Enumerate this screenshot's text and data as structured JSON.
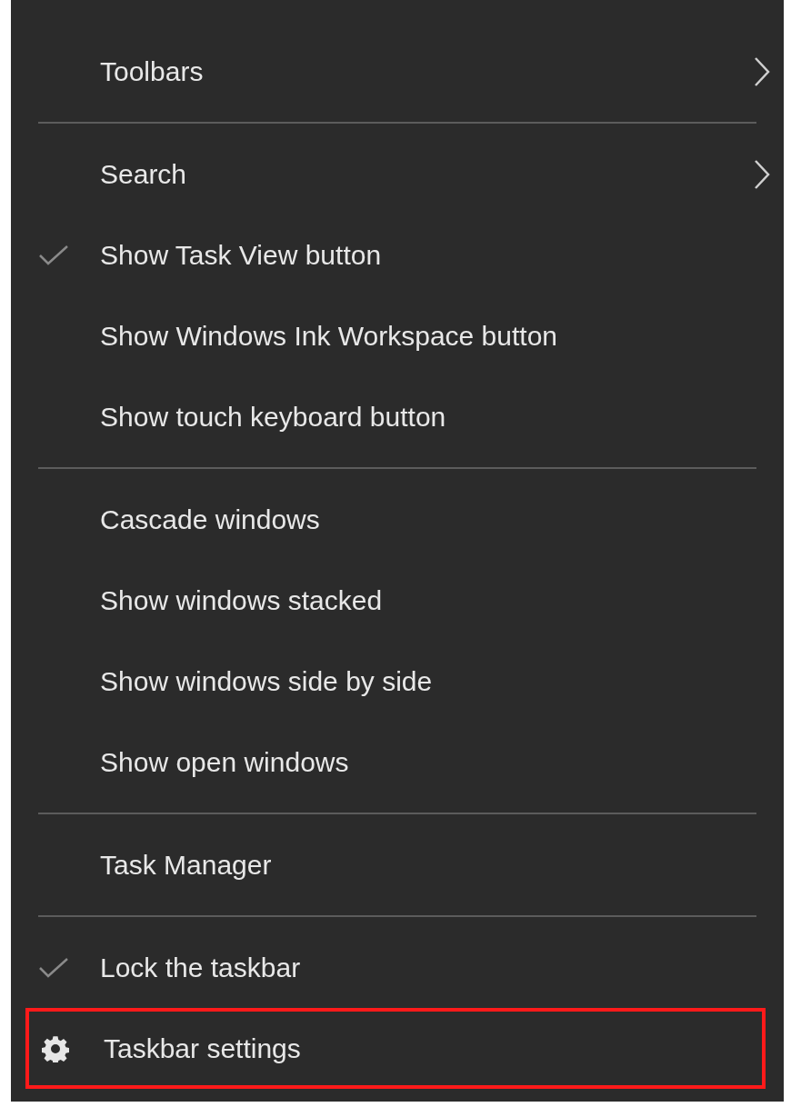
{
  "menu": {
    "items": [
      {
        "kind": "item",
        "label": "Toolbars",
        "submenu": true,
        "checked": false,
        "highlighted": false
      },
      {
        "kind": "separator"
      },
      {
        "kind": "item",
        "label": "Search",
        "submenu": true,
        "checked": false,
        "highlighted": false
      },
      {
        "kind": "item",
        "label": "Show Task View button",
        "submenu": false,
        "checked": true,
        "highlighted": false
      },
      {
        "kind": "item",
        "label": "Show Windows Ink Workspace button",
        "submenu": false,
        "checked": false,
        "highlighted": false
      },
      {
        "kind": "item",
        "label": "Show touch keyboard button",
        "submenu": false,
        "checked": false,
        "highlighted": false
      },
      {
        "kind": "separator"
      },
      {
        "kind": "item",
        "label": "Cascade windows",
        "submenu": false,
        "checked": false,
        "highlighted": false
      },
      {
        "kind": "item",
        "label": "Show windows stacked",
        "submenu": false,
        "checked": false,
        "highlighted": false
      },
      {
        "kind": "item",
        "label": "Show windows side by side",
        "submenu": false,
        "checked": false,
        "highlighted": false
      },
      {
        "kind": "item",
        "label": "Show open windows",
        "submenu": false,
        "checked": false,
        "highlighted": false
      },
      {
        "kind": "separator"
      },
      {
        "kind": "item",
        "label": "Task Manager",
        "submenu": false,
        "checked": false,
        "highlighted": false
      },
      {
        "kind": "separator"
      },
      {
        "kind": "item",
        "label": "Lock the taskbar",
        "submenu": false,
        "checked": true,
        "highlighted": false
      },
      {
        "kind": "settings",
        "label": "Taskbar settings",
        "submenu": false,
        "highlighted": true
      }
    ]
  }
}
